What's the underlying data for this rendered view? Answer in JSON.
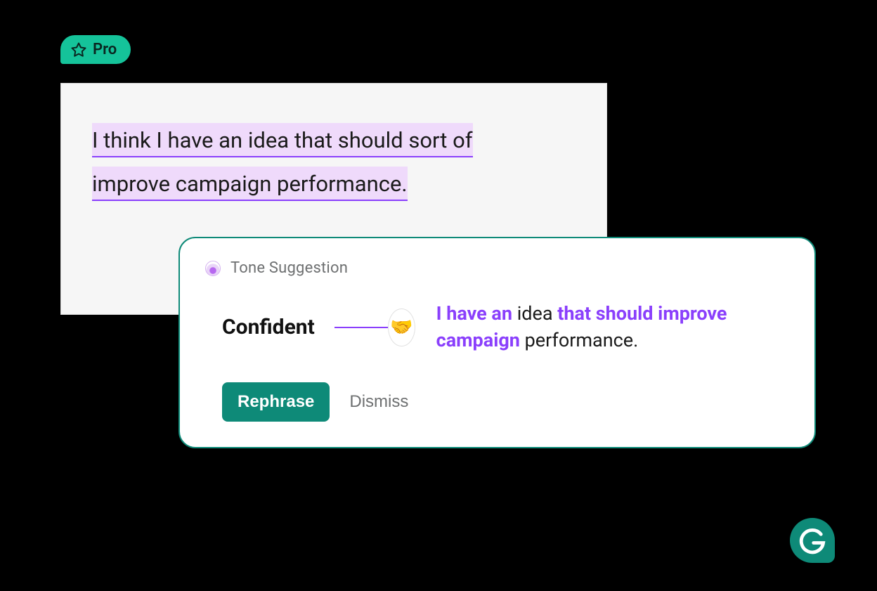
{
  "badge": {
    "label": "Pro"
  },
  "editor": {
    "line1": "I think I have an idea that should sort of",
    "line2": "improve campaign performance."
  },
  "suggestion": {
    "header_label": "Tone Suggestion",
    "tone_name": "Confident",
    "emoji": "🤝",
    "rewrite": {
      "p1_bold": "I have an",
      "p2_plain": " idea ",
      "p3_bold": "that should improve campaign",
      "p4_plain": " performance."
    },
    "actions": {
      "primary": "Rephrase",
      "dismiss": "Dismiss"
    }
  },
  "colors": {
    "accent_green": "#15C39A",
    "brand_green": "#0E8A78",
    "highlight_purple": "#8A3FFC",
    "highlight_bg": "#EFDAFB"
  }
}
